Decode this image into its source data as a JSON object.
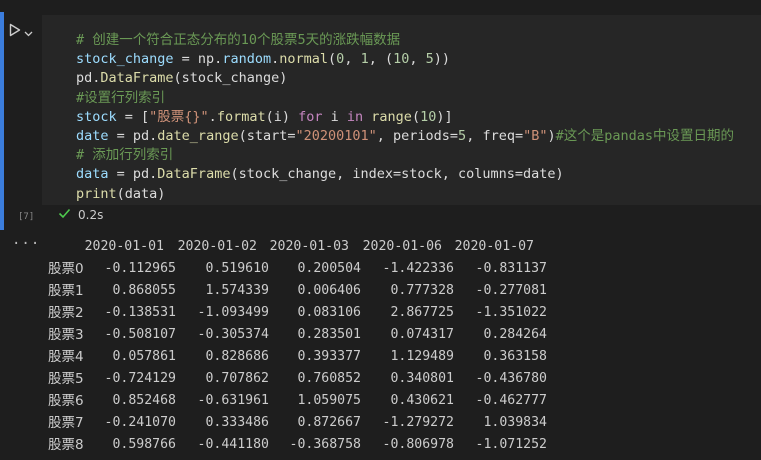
{
  "cell": {
    "exec_count": "[7]",
    "status_time": "0.2s",
    "code": [
      [
        {
          "t": "# 创建一个符合正态分布的10个股票5天的涨跌幅数据",
          "c": "cm"
        }
      ],
      [
        {
          "t": "stock_change",
          "c": "var"
        },
        {
          "t": " = np.",
          "c": "id"
        },
        {
          "t": "random",
          "c": "var"
        },
        {
          "t": ".",
          "c": "id"
        },
        {
          "t": "normal",
          "c": "fn"
        },
        {
          "t": "(",
          "c": "id"
        },
        {
          "t": "0",
          "c": "num"
        },
        {
          "t": ", ",
          "c": "id"
        },
        {
          "t": "1",
          "c": "num"
        },
        {
          "t": ", (",
          "c": "id"
        },
        {
          "t": "10",
          "c": "num"
        },
        {
          "t": ", ",
          "c": "id"
        },
        {
          "t": "5",
          "c": "num"
        },
        {
          "t": "))",
          "c": "id"
        }
      ],
      [
        {
          "t": "pd.",
          "c": "id"
        },
        {
          "t": "DataFrame",
          "c": "fn"
        },
        {
          "t": "(stock_change)",
          "c": "id"
        }
      ],
      [
        {
          "t": "#设置行列索引",
          "c": "cm"
        }
      ],
      [
        {
          "t": "stock",
          "c": "var"
        },
        {
          "t": " = [",
          "c": "id"
        },
        {
          "t": "\"股票{}\"",
          "c": "str"
        },
        {
          "t": ".",
          "c": "id"
        },
        {
          "t": "format",
          "c": "fn"
        },
        {
          "t": "(i) ",
          "c": "id"
        },
        {
          "t": "for",
          "c": "kw"
        },
        {
          "t": " i ",
          "c": "id"
        },
        {
          "t": "in",
          "c": "kw"
        },
        {
          "t": " ",
          "c": "id"
        },
        {
          "t": "range",
          "c": "fn"
        },
        {
          "t": "(",
          "c": "id"
        },
        {
          "t": "10",
          "c": "num"
        },
        {
          "t": ")]",
          "c": "id"
        }
      ],
      [
        {
          "t": "date",
          "c": "var"
        },
        {
          "t": " = pd.",
          "c": "id"
        },
        {
          "t": "date_range",
          "c": "fn"
        },
        {
          "t": "(start=",
          "c": "id"
        },
        {
          "t": "\"20200101\"",
          "c": "str"
        },
        {
          "t": ", periods=",
          "c": "id"
        },
        {
          "t": "5",
          "c": "num"
        },
        {
          "t": ", freq=",
          "c": "id"
        },
        {
          "t": "\"B\"",
          "c": "str"
        },
        {
          "t": ")",
          "c": "id"
        },
        {
          "t": "#这个是pandas中设置日期的",
          "c": "cm"
        }
      ],
      [
        {
          "t": "# 添加行列索引",
          "c": "cm"
        }
      ],
      [
        {
          "t": "data",
          "c": "var"
        },
        {
          "t": " = pd.",
          "c": "id"
        },
        {
          "t": "DataFrame",
          "c": "fn"
        },
        {
          "t": "(stock_change, index=stock, columns=date)",
          "c": "id"
        }
      ],
      [
        {
          "t": "print",
          "c": "fn"
        },
        {
          "t": "(data)",
          "c": "id"
        }
      ]
    ]
  },
  "output": {
    "more": "···",
    "columns": [
      "2020-01-01",
      "2020-01-02",
      "2020-01-03",
      "2020-01-06",
      "2020-01-07"
    ],
    "rows": [
      {
        "label": "股票0",
        "values": [
          "-0.112965",
          "0.519610",
          "0.200504",
          "-1.422336",
          "-0.831137"
        ]
      },
      {
        "label": "股票1",
        "values": [
          "0.868055",
          "1.574339",
          "0.006406",
          "0.777328",
          "-0.277081"
        ]
      },
      {
        "label": "股票2",
        "values": [
          "-0.138531",
          "-1.093499",
          "0.083106",
          "2.867725",
          "-1.351022"
        ]
      },
      {
        "label": "股票3",
        "values": [
          "-0.508107",
          "-0.305374",
          "0.283501",
          "0.074317",
          "0.284264"
        ]
      },
      {
        "label": "股票4",
        "values": [
          "0.057861",
          "0.828686",
          "0.393377",
          "1.129489",
          "0.363158"
        ]
      },
      {
        "label": "股票5",
        "values": [
          "-0.724129",
          "0.707862",
          "0.760852",
          "0.340801",
          "-0.436780"
        ]
      },
      {
        "label": "股票6",
        "values": [
          "0.852468",
          "-0.631961",
          "1.059075",
          "0.430621",
          "-0.462777"
        ]
      },
      {
        "label": "股票7",
        "values": [
          "-0.241070",
          "0.333486",
          "0.872667",
          "-1.279272",
          "1.039834"
        ]
      },
      {
        "label": "股票8",
        "values": [
          "0.598766",
          "-0.441180",
          "-0.368758",
          "-0.806978",
          "-1.071252"
        ]
      }
    ]
  },
  "icons": {
    "run": "play-icon",
    "dropdown": "chevron-down-icon",
    "success": "checkmark-icon"
  },
  "colors": {
    "accent": "#3b7ddd",
    "success": "#4ec94e",
    "background": "#1e1e1e",
    "code_bg": "#262626"
  }
}
